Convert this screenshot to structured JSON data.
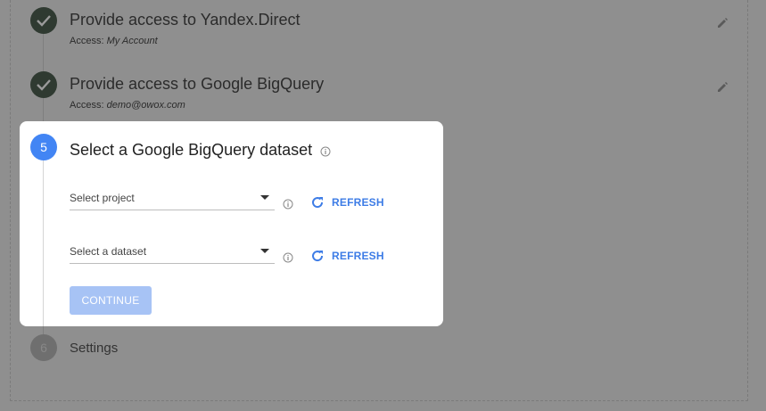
{
  "steps": [
    {
      "title": "Provide access to Yandex.Direct",
      "sub_label": "Access:",
      "sub_value": "My Account"
    },
    {
      "title": "Provide access to Google BigQuery",
      "sub_label": "Access:",
      "sub_value": "demo@owox.com"
    }
  ],
  "active_step": {
    "number": "5",
    "title": "Select a Google BigQuery dataset",
    "project_select": "Select project",
    "dataset_select": "Select a dataset",
    "refresh_label": "REFRESH",
    "continue_label": "CONTINUE"
  },
  "next_step": {
    "number": "6",
    "title": "Settings"
  },
  "colors": {
    "accent": "#4285f4",
    "done": "#2f3a31",
    "overlay": "#8f8f8f"
  }
}
